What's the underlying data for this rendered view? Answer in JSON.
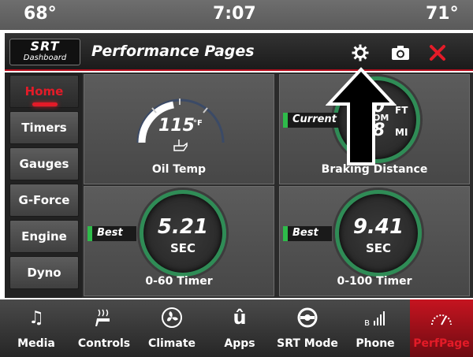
{
  "status": {
    "temp_left": "68°",
    "clock": "7:07",
    "temp_right": "71°"
  },
  "header": {
    "logo_line1": "SRT",
    "logo_line2": "Dashboard",
    "title": "Performance Pages",
    "icons": [
      "gear-icon",
      "camera-icon",
      "close-icon"
    ],
    "close_color": "#e41b28"
  },
  "sidebar": {
    "items": [
      {
        "label": "Home",
        "active": true
      },
      {
        "label": "Timers"
      },
      {
        "label": "Gauges"
      },
      {
        "label": "G-Force"
      },
      {
        "label": "Engine"
      },
      {
        "label": "Dyno"
      }
    ]
  },
  "tiles": {
    "oil_temp": {
      "value": "115",
      "unit": "°F",
      "label": "Oil Temp"
    },
    "braking": {
      "tag": "Current",
      "value1": "0",
      "unit1": "FT",
      "mid": "OM",
      "value2": "8",
      "unit2": "MI",
      "label": "Braking Distance"
    },
    "timer060": {
      "tag": "Best",
      "value": "5.21",
      "unit": "SEC",
      "label": "0-60 Timer"
    },
    "timer0100": {
      "tag": "Best",
      "value": "9.41",
      "unit": "SEC",
      "label": "0-100 Timer"
    }
  },
  "bottom_nav": [
    {
      "label": "Media",
      "icon": "music-note-icon"
    },
    {
      "label": "Controls",
      "icon": "seat-heat-icon"
    },
    {
      "label": "Climate",
      "icon": "fan-icon"
    },
    {
      "label": "Apps",
      "icon": "apps-icon"
    },
    {
      "label": "SRT Mode",
      "icon": "steering-wheel-icon"
    },
    {
      "label": "Phone",
      "icon": "phone-signal-icon"
    },
    {
      "label": "PerfPage",
      "icon": "gauge-icon",
      "active": true
    }
  ],
  "colors": {
    "accent_red": "#e41b28",
    "ring_green": "#2f8c56",
    "tag_green": "#2ebb4a"
  }
}
